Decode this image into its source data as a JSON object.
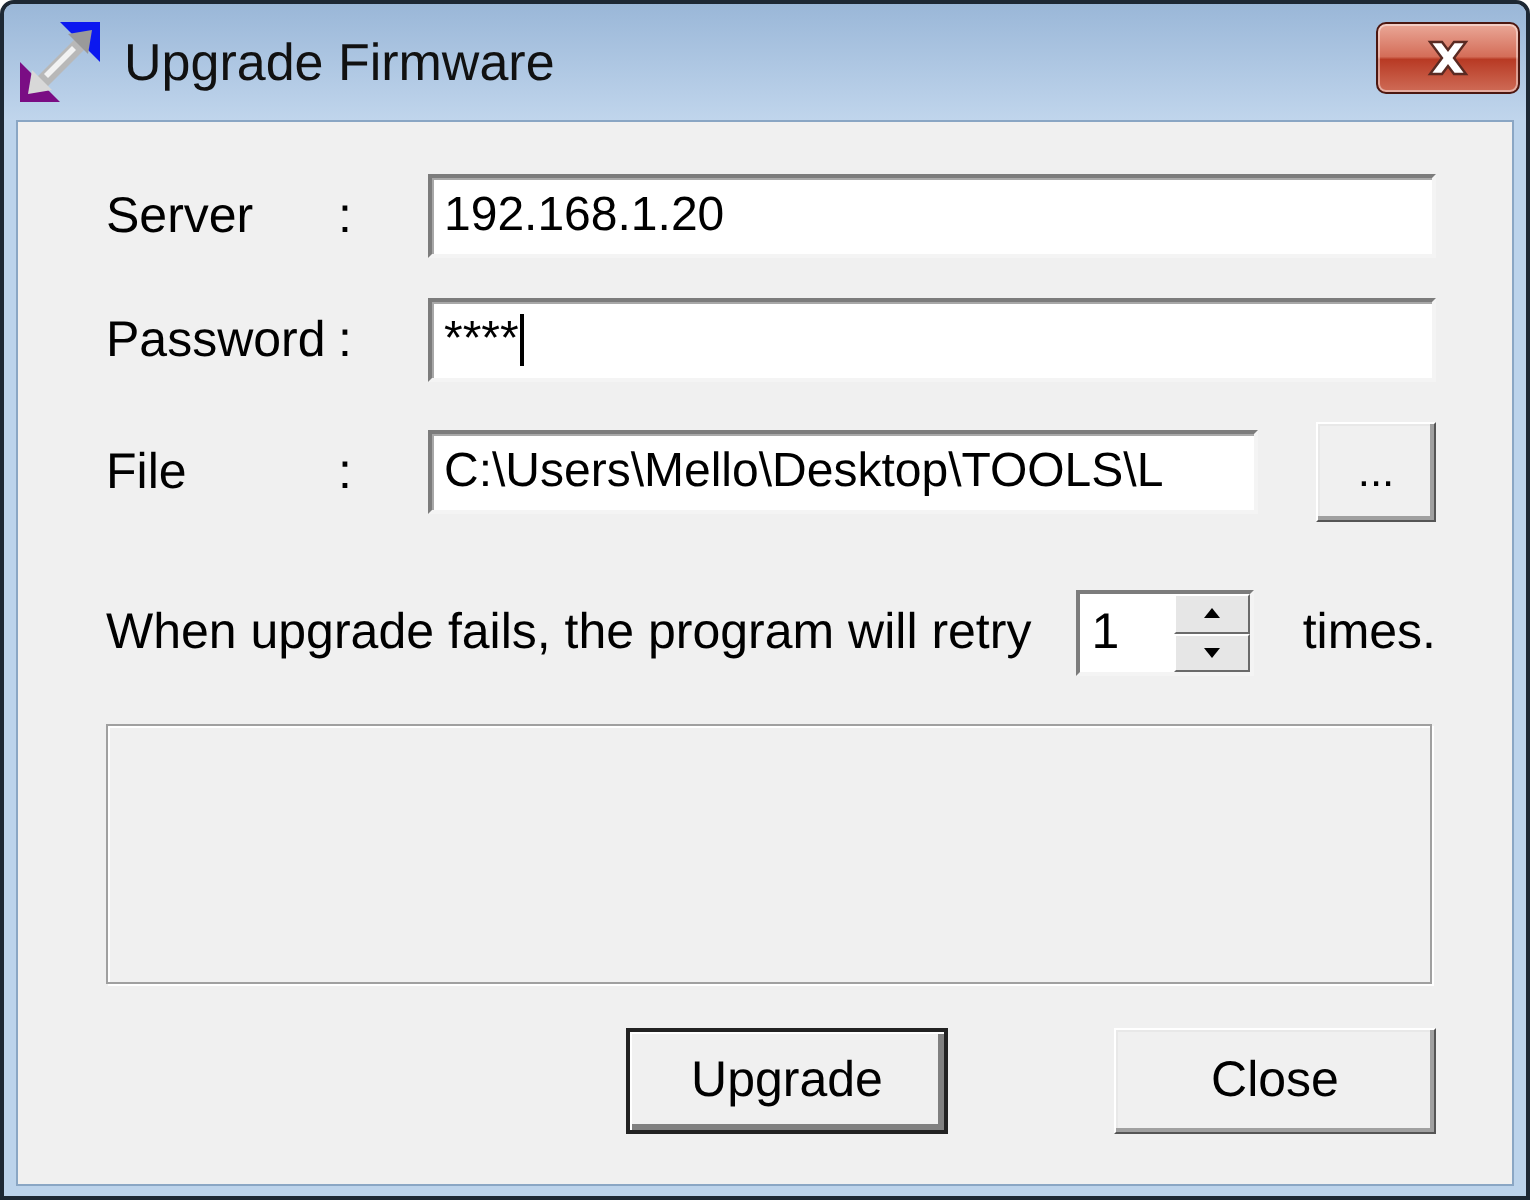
{
  "window": {
    "title": "Upgrade Firmware"
  },
  "fields": [
    {
      "label": "Server",
      "separator": ":",
      "value": "192.168.1.20",
      "focused": false
    },
    {
      "label": "Password",
      "separator": ":",
      "value": "****",
      "focused": true
    },
    {
      "label": "File",
      "separator": ":",
      "value": "C:\\Users\\Mello\\Desktop\\TOOLS\\L",
      "focused": false,
      "browse_button": "..."
    }
  ],
  "retry": {
    "text_before": "When upgrade fails, the program will retry",
    "value": "1",
    "text_after": "times."
  },
  "buttons": [
    {
      "label": "Upgrade",
      "default": true
    },
    {
      "label": "Close",
      "default": false
    }
  ]
}
